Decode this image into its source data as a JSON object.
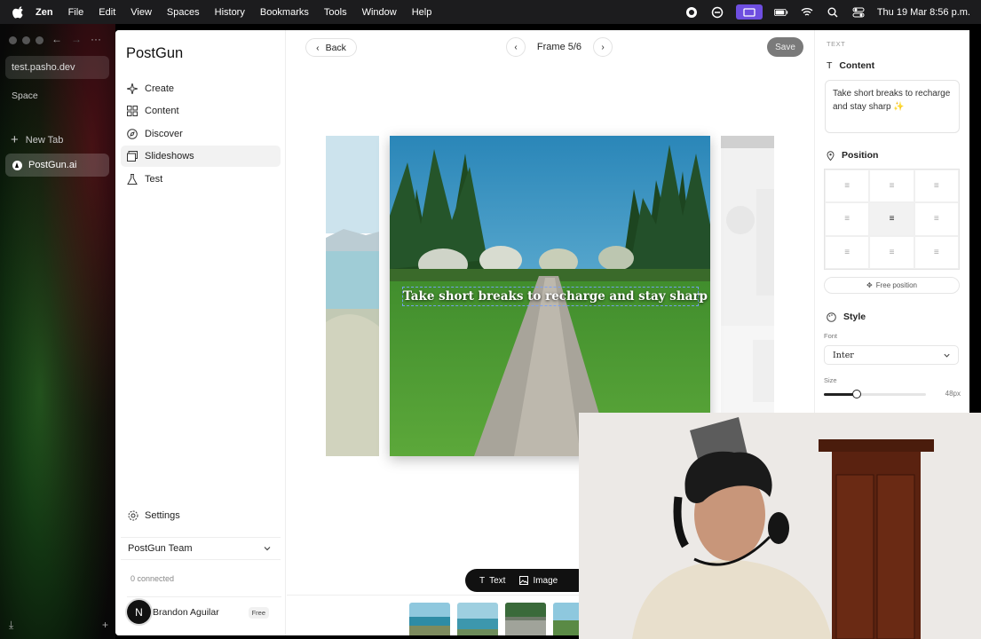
{
  "menubar": {
    "app": "Zen",
    "items": [
      "File",
      "Edit",
      "View",
      "Spaces",
      "History",
      "Bookmarks",
      "Tools",
      "Window",
      "Help"
    ],
    "datetime": "Thu 19 Mar  8:56 p.m."
  },
  "browser": {
    "url": "test.pasho.dev",
    "space_label": "Space",
    "new_tab": "New Tab",
    "active_tab": "PostGun.ai"
  },
  "nav": {
    "brand": "PostGun",
    "items": [
      {
        "label": "Create",
        "icon": "sparkle-icon"
      },
      {
        "label": "Content",
        "icon": "grid-icon"
      },
      {
        "label": "Discover",
        "icon": "compass-icon"
      },
      {
        "label": "Slideshows",
        "icon": "slides-icon"
      },
      {
        "label": "Test",
        "icon": "flask-icon"
      }
    ],
    "active_index": 3,
    "settings": "Settings",
    "team": "PostGun Team",
    "connected": "0 connected",
    "user_initial": "N",
    "user_name": "Brandon Aguilar",
    "plan": "Free"
  },
  "editor": {
    "back": "Back",
    "frame": "Frame 5/6",
    "save": "Save",
    "slide_text": "Take short breaks to recharge and stay sharp ✨",
    "toolbar": {
      "text": "Text",
      "image": "Image"
    },
    "thumbnails": [
      "1",
      "2",
      "3",
      "4"
    ]
  },
  "panel": {
    "section_label": "TEXT",
    "content_title": "Content",
    "content_value": "Take short breaks to recharge and stay sharp ✨",
    "position_title": "Position",
    "position_selected": "middle-center",
    "free_position": "Free position",
    "style_title": "Style",
    "font_label": "Font",
    "font_value": "Inter",
    "size_label": "Size",
    "size_value": "48px",
    "size_fraction": 0.32
  },
  "colors": {
    "menubar_bg": "#1c1c1e",
    "accent_purple": "#6e4ee0",
    "save_btn": "#7a7a7a",
    "toolbar_bg": "#111111"
  }
}
